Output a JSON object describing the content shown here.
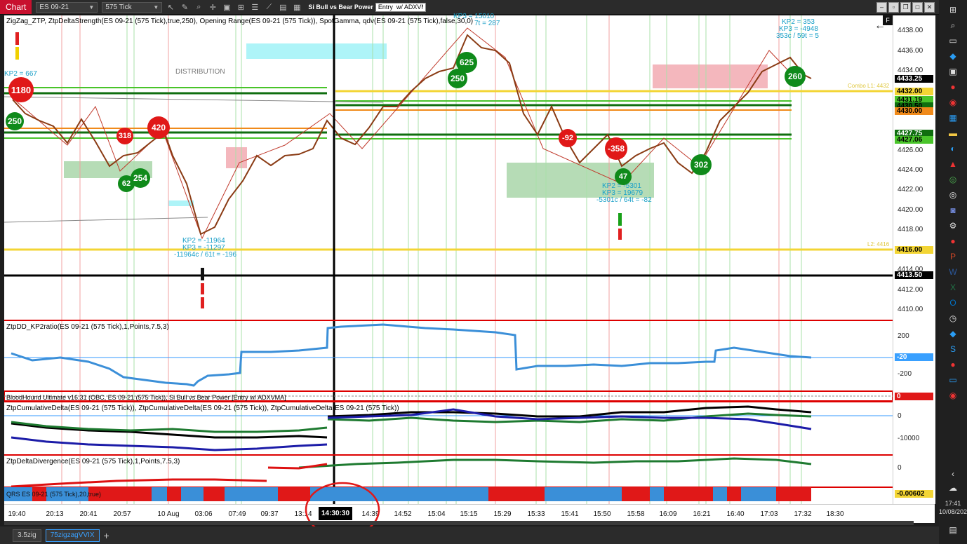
{
  "toolbar": {
    "chart_tab": "Chart",
    "instrument": "ES 09-21",
    "interval": "575 Tick",
    "strategy_label": "Si Bull vs Bear Power",
    "entry_value": "Entry  w/ ADXVMA"
  },
  "chart": {
    "indicator_title_main": "ZigZag_ZTP, ZtpDeltaStrength(ES 09-21 (575 Tick),true,250), Opening Range(ES 09-21 (575 Tick)), SpotGamma, qdv(ES 09-21 (575 Tick),false,30,0)",
    "distribution_label": "DISTRIBUTION",
    "annotations": {
      "kp_left": "KP2 = 667",
      "kp_top_right_1": "KP2 = 353",
      "kp_top_right_2": "KP3 = -4948",
      "kp_top_right_3": "353c / 59t = 5",
      "kp_mid_1": "KP2 = -11964",
      "kp_mid_2": "KP3 = -11297",
      "kp_mid_3": "-11964c / 61t = -196",
      "kp_center_1": "KP2 = -5301",
      "kp_center_2": "KP3 = 19679",
      "kp_center_3": "-5301c / 64t = -82",
      "kp_top_center": "KP3 = 15010",
      "kp_top_center_b": "7t = 287",
      "combo_label": "Combo L1: 4432",
      "l2_label": "L2: 4416"
    },
    "bubbles": {
      "b1180": "1180",
      "b250a": "250",
      "b318": "318",
      "b420": "420",
      "b62": "62",
      "b254": "254",
      "b625": "625",
      "b250b": "250",
      "b260": "260",
      "b92": "-92",
      "b358": "-358",
      "b47": "47",
      "b302": "302"
    },
    "panel2_title": "ZtpDD_KP2ratio(ES 09-21 (575 Tick),1,Points,7.5,3)",
    "panel3_title": "BloodHound Ultimate v16.31 (OBC, ES 09-21 (575 Tick)), Si Bull vs Bear Power  [Entry  w/ ADXVMA]",
    "panel4_title": "ZtpCumulativeDelta(ES 09-21 (575 Tick)), ZtpCumulativeDelta(ES 09-21 (575 Tick)), ZtpCumulativeDelta(ES 09-21 (575 Tick))",
    "panel5_title": "ZtpDeltaDivergence(ES 09-21 (575 Tick),1,Points,7.5,3)",
    "panel6_title": "QRS ES 09-21 (575 Tick),20,true)"
  },
  "price_axis": {
    "ticks": [
      "4438.00",
      "4436.00",
      "4434.00",
      "4426.00",
      "4424.00",
      "4422.00",
      "4420.00",
      "4418.00",
      "4414.00",
      "4412.00",
      "4410.00"
    ],
    "tags": {
      "last": "4433.25",
      "combo": "4432.00",
      "g1": "4431.19",
      "g2": "4430.50",
      "orange": "4430.00",
      "g3": "4427.75",
      "g4": "4427.06",
      "l2": "4416.00",
      "cursor": "4413.50"
    },
    "panel2_ticks": [
      "200",
      "-200"
    ],
    "panel2_tag": "-20",
    "panel3_tag": "0",
    "panel4_ticks": [
      "0",
      "-10000"
    ],
    "panel5_tick": "0",
    "panel6_tag": "-0.00602"
  },
  "time_axis": {
    "labels": [
      "19:40",
      "20:13",
      "20:41",
      "20:57",
      "10 Aug",
      "03:06",
      "07:49",
      "09:37",
      "13:14",
      "14:39",
      "14:52",
      "15:04",
      "15:15",
      "15:29",
      "15:33",
      "15:41",
      "15:50",
      "15:58",
      "16:09",
      "16:21",
      "16:40",
      "17:03",
      "17:32",
      "18:30"
    ],
    "selected": "14:30:30"
  },
  "bottom_tabs": {
    "tab1": "3.5zig",
    "tab2": "75zigzagVVIX",
    "add": "+"
  },
  "taskbar": {
    "time": "17:41",
    "date": "10/08/2021"
  }
}
